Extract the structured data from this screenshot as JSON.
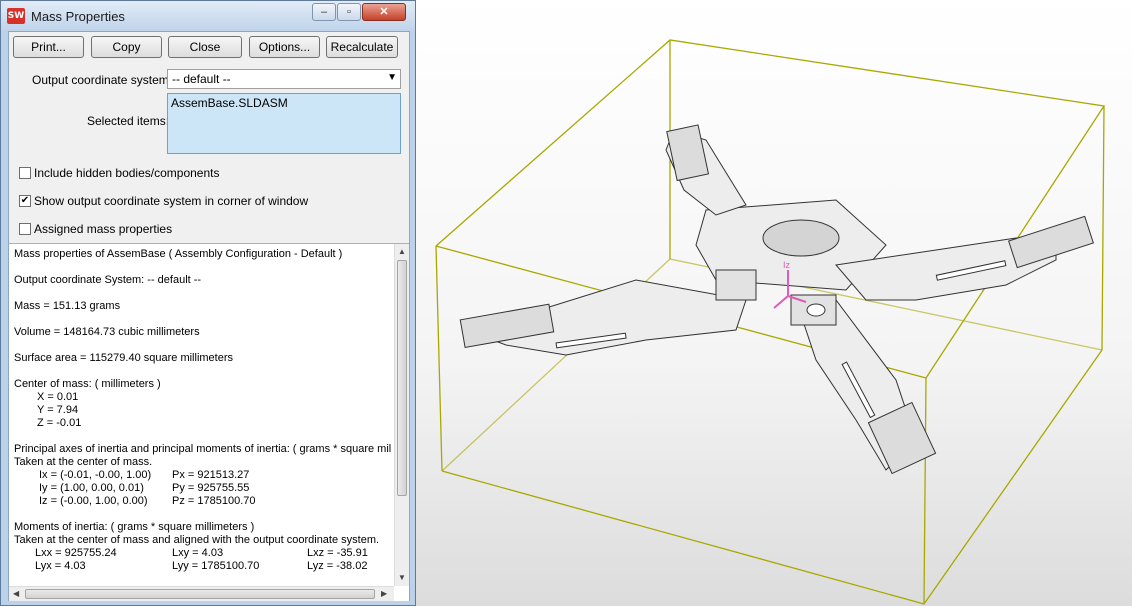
{
  "window": {
    "title": "Mass Properties",
    "app_icon": "SW",
    "minimize": "–",
    "maximize": "▫",
    "close": "✕"
  },
  "buttons": {
    "print": "Print...",
    "copy": "Copy",
    "close": "Close",
    "options": "Options...",
    "recalculate": "Recalculate"
  },
  "coord": {
    "label": "Output coordinate system:",
    "value": "-- default --"
  },
  "selected": {
    "label": "Selected items:",
    "value": "AssemBase.SLDASM"
  },
  "options": {
    "hidden": {
      "label": "Include hidden bodies/components",
      "checked": false
    },
    "show_coord": {
      "label": "Show output coordinate system in corner of window",
      "checked": true
    },
    "assigned": {
      "label": "Assigned mass properties",
      "checked": false
    }
  },
  "results": {
    "header": "Mass properties of AssemBase ( Assembly Configuration - Default )",
    "output_cs": "Output  coordinate System: -- default --",
    "mass": "Mass = 151.13 grams",
    "volume": "Volume = 148164.73  cubic millimeters",
    "surface": "Surface area = 115279.40  square millimeters",
    "com_label": "Center of mass: ( millimeters )",
    "com_x": "X = 0.01",
    "com_y": "Y = 7.94",
    "com_z": "Z = -0.01",
    "principal_label": "Principal axes of inertia and principal moments of inertia: ( grams *  square mil",
    "principal_taken": "Taken at the center of mass.",
    "ix": "Ix = (-0.01, -0.00, 1.00)",
    "iy": "Iy = (1.00, 0.00, 0.01)",
    "iz": "Iz = (-0.00, 1.00, 0.00)",
    "px": "Px = 921513.27",
    "py": "Py = 925755.55",
    "pz": "Pz = 1785100.70",
    "moments_label": "Moments of inertia: ( grams *  square millimeters )",
    "moments_taken": "Taken at the center of mass and aligned with the output coordinate system.",
    "lxx": "Lxx = 925755.24",
    "lxy": "Lxy = 4.03",
    "lxz": "Lxz = -35.91",
    "lyx": "Lyx = 4.03",
    "lyy": "Lyy = 1785100.70",
    "lyz": "Lyz = -38.02"
  },
  "viewport": {
    "axis_label": "Iz",
    "bbox_color": "#a8a800",
    "triad_color": "#e05ab8"
  }
}
